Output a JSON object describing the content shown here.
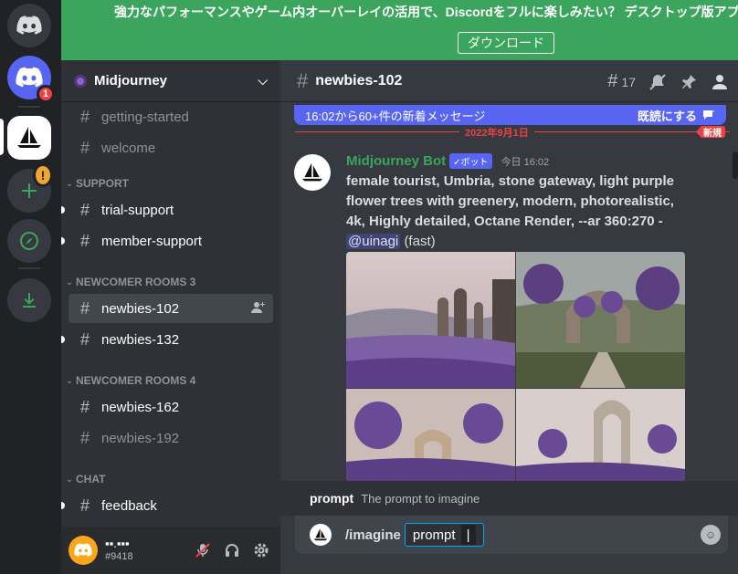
{
  "colors": {
    "accent": "#5865f2",
    "green": "#3ba55d",
    "red": "#ed4245",
    "bg": "#36393f"
  },
  "rail": {
    "home_icon": "discord-logo-icon",
    "dm_badge": "1",
    "alert_mark": "!"
  },
  "notice": {
    "text": "強力なパフォーマンスやゲーム内オーバーレイの活用で、Discordをフルに楽しみたい？ デスクトップ版アプ",
    "button": "ダウンロード"
  },
  "guild": {
    "name": "Midjourney"
  },
  "channels": [
    {
      "name": "getting-started",
      "state": "read"
    },
    {
      "name": "welcome",
      "state": "read"
    },
    {
      "category": "SUPPORT"
    },
    {
      "name": "trial-support",
      "state": "unread"
    },
    {
      "name": "member-support",
      "state": "unread"
    },
    {
      "category": "NEWCOMER ROOMS 3"
    },
    {
      "name": "newbies-102",
      "state": "active"
    },
    {
      "name": "newbies-132",
      "state": "unread"
    },
    {
      "category": "NEWCOMER ROOMS 4"
    },
    {
      "name": "newbies-162",
      "state": "unread"
    },
    {
      "name": "newbies-192",
      "state": "read"
    },
    {
      "category": "CHAT"
    },
    {
      "name": "feedback",
      "state": "unread"
    }
  ],
  "user": {
    "name": "▪▪.▪▪▪",
    "tag": "#9418"
  },
  "chat": {
    "channel_name": "newbies-102",
    "thread_count": "17",
    "new_messages": "16:02から60+件の新着メッセージ",
    "mark_read": "既読にする",
    "date_divider": "2022年9月1日",
    "new_label": "新規",
    "author": "Midjourney Bot",
    "bot_tag": "✓ボット",
    "timestamp": "今日 16:02",
    "prompt_text": "female tourist, Umbria, stone gateway, light purple flower trees with greenery, modern, photorealistic, 4k, Highly detailed, Octane Render, --ar 360:270 - ",
    "mention": "@uinagi",
    "speed": "(fast)",
    "hint_name": "prompt",
    "hint_desc": "The prompt to imagine",
    "command": "/imagine",
    "option": "prompt"
  }
}
